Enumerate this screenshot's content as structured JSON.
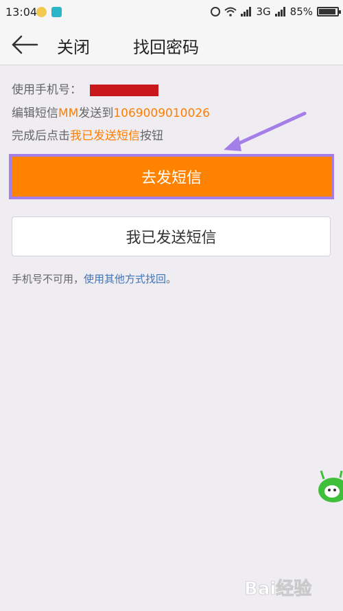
{
  "status_bar": {
    "time": "13:04",
    "network": "3G",
    "battery": "85%"
  },
  "nav": {
    "close_label": "关闭",
    "title": "找回密码"
  },
  "info": {
    "phone_label": "使用手机号：",
    "line2_prefix": "编辑短信",
    "line2_code": "MM",
    "line2_mid": "发送到",
    "line2_number": "1069009010026",
    "line3_prefix": "完成后点击",
    "line3_highlight": "我已发送短信",
    "line3_suffix": "按钮"
  },
  "buttons": {
    "send_sms": "去发短信",
    "sent_sms": "我已发送短信"
  },
  "footer": {
    "prefix": "手机号不可用，",
    "link": "使用其他方式找回",
    "suffix": "。"
  },
  "watermark": {
    "text": "Bai经验"
  },
  "colors": {
    "accent": "#ff8300",
    "highlight_border": "#a57fe8",
    "link": "#3d73b8",
    "redaction": "#c8181b"
  }
}
